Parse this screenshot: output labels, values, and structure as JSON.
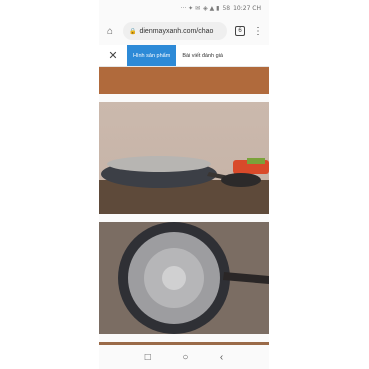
{
  "status": {
    "left_icons": "··· ✦ ✉",
    "signal_icons": "◈ ▲ ▮",
    "battery": "58",
    "time": "10:27 CH"
  },
  "browser": {
    "url": "dienmayxanh.com/chao",
    "tab_count": "6"
  },
  "tabs": {
    "product_images": "Hình sản phẩm",
    "review_articles": "Bài viết đánh giá"
  },
  "nav": {
    "recents": "□",
    "home": "○",
    "back": "‹"
  }
}
